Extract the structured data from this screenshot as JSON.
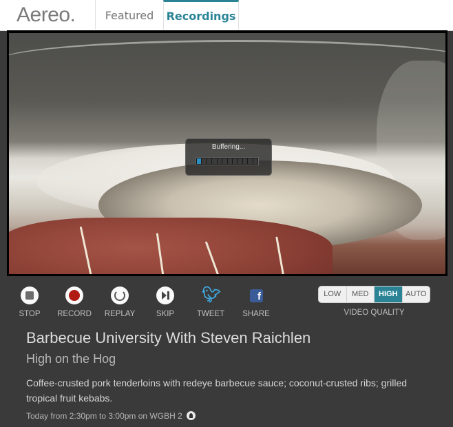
{
  "app": {
    "logo": "Aereo."
  },
  "tabs": [
    {
      "label": "Featured",
      "active": false
    },
    {
      "label": "Recordings",
      "active": true
    }
  ],
  "player": {
    "buffering_text": "Buffering...",
    "buffer_progress_fraction": 0.12
  },
  "controls": [
    {
      "label": "STOP",
      "icon": "stop-icon"
    },
    {
      "label": "RECORD",
      "icon": "record-icon"
    },
    {
      "label": "REPLAY",
      "icon": "replay-icon"
    },
    {
      "label": "SKIP",
      "icon": "skip-icon"
    },
    {
      "label": "TWEET",
      "icon": "twitter-icon"
    },
    {
      "label": "SHARE",
      "icon": "facebook-icon"
    }
  ],
  "quality": {
    "options": [
      "LOW",
      "MED",
      "HIGH",
      "AUTO"
    ],
    "selected": "HIGH",
    "label": "VIDEO QUALITY"
  },
  "program": {
    "title": "Barbecue University With Steven Raichlen",
    "episode": "High on the Hog",
    "description": "Coffee-crusted pork tenderloins with redeye barbecue sauce; coconut-crusted ribs; grilled tropical fruit kebabs.",
    "airtime": "Today from 2:30pm to 3:00pm on WGBH 2"
  },
  "colors": {
    "accent": "#2a8496",
    "record": "#b01c14",
    "panel": "#3a3a3a"
  }
}
